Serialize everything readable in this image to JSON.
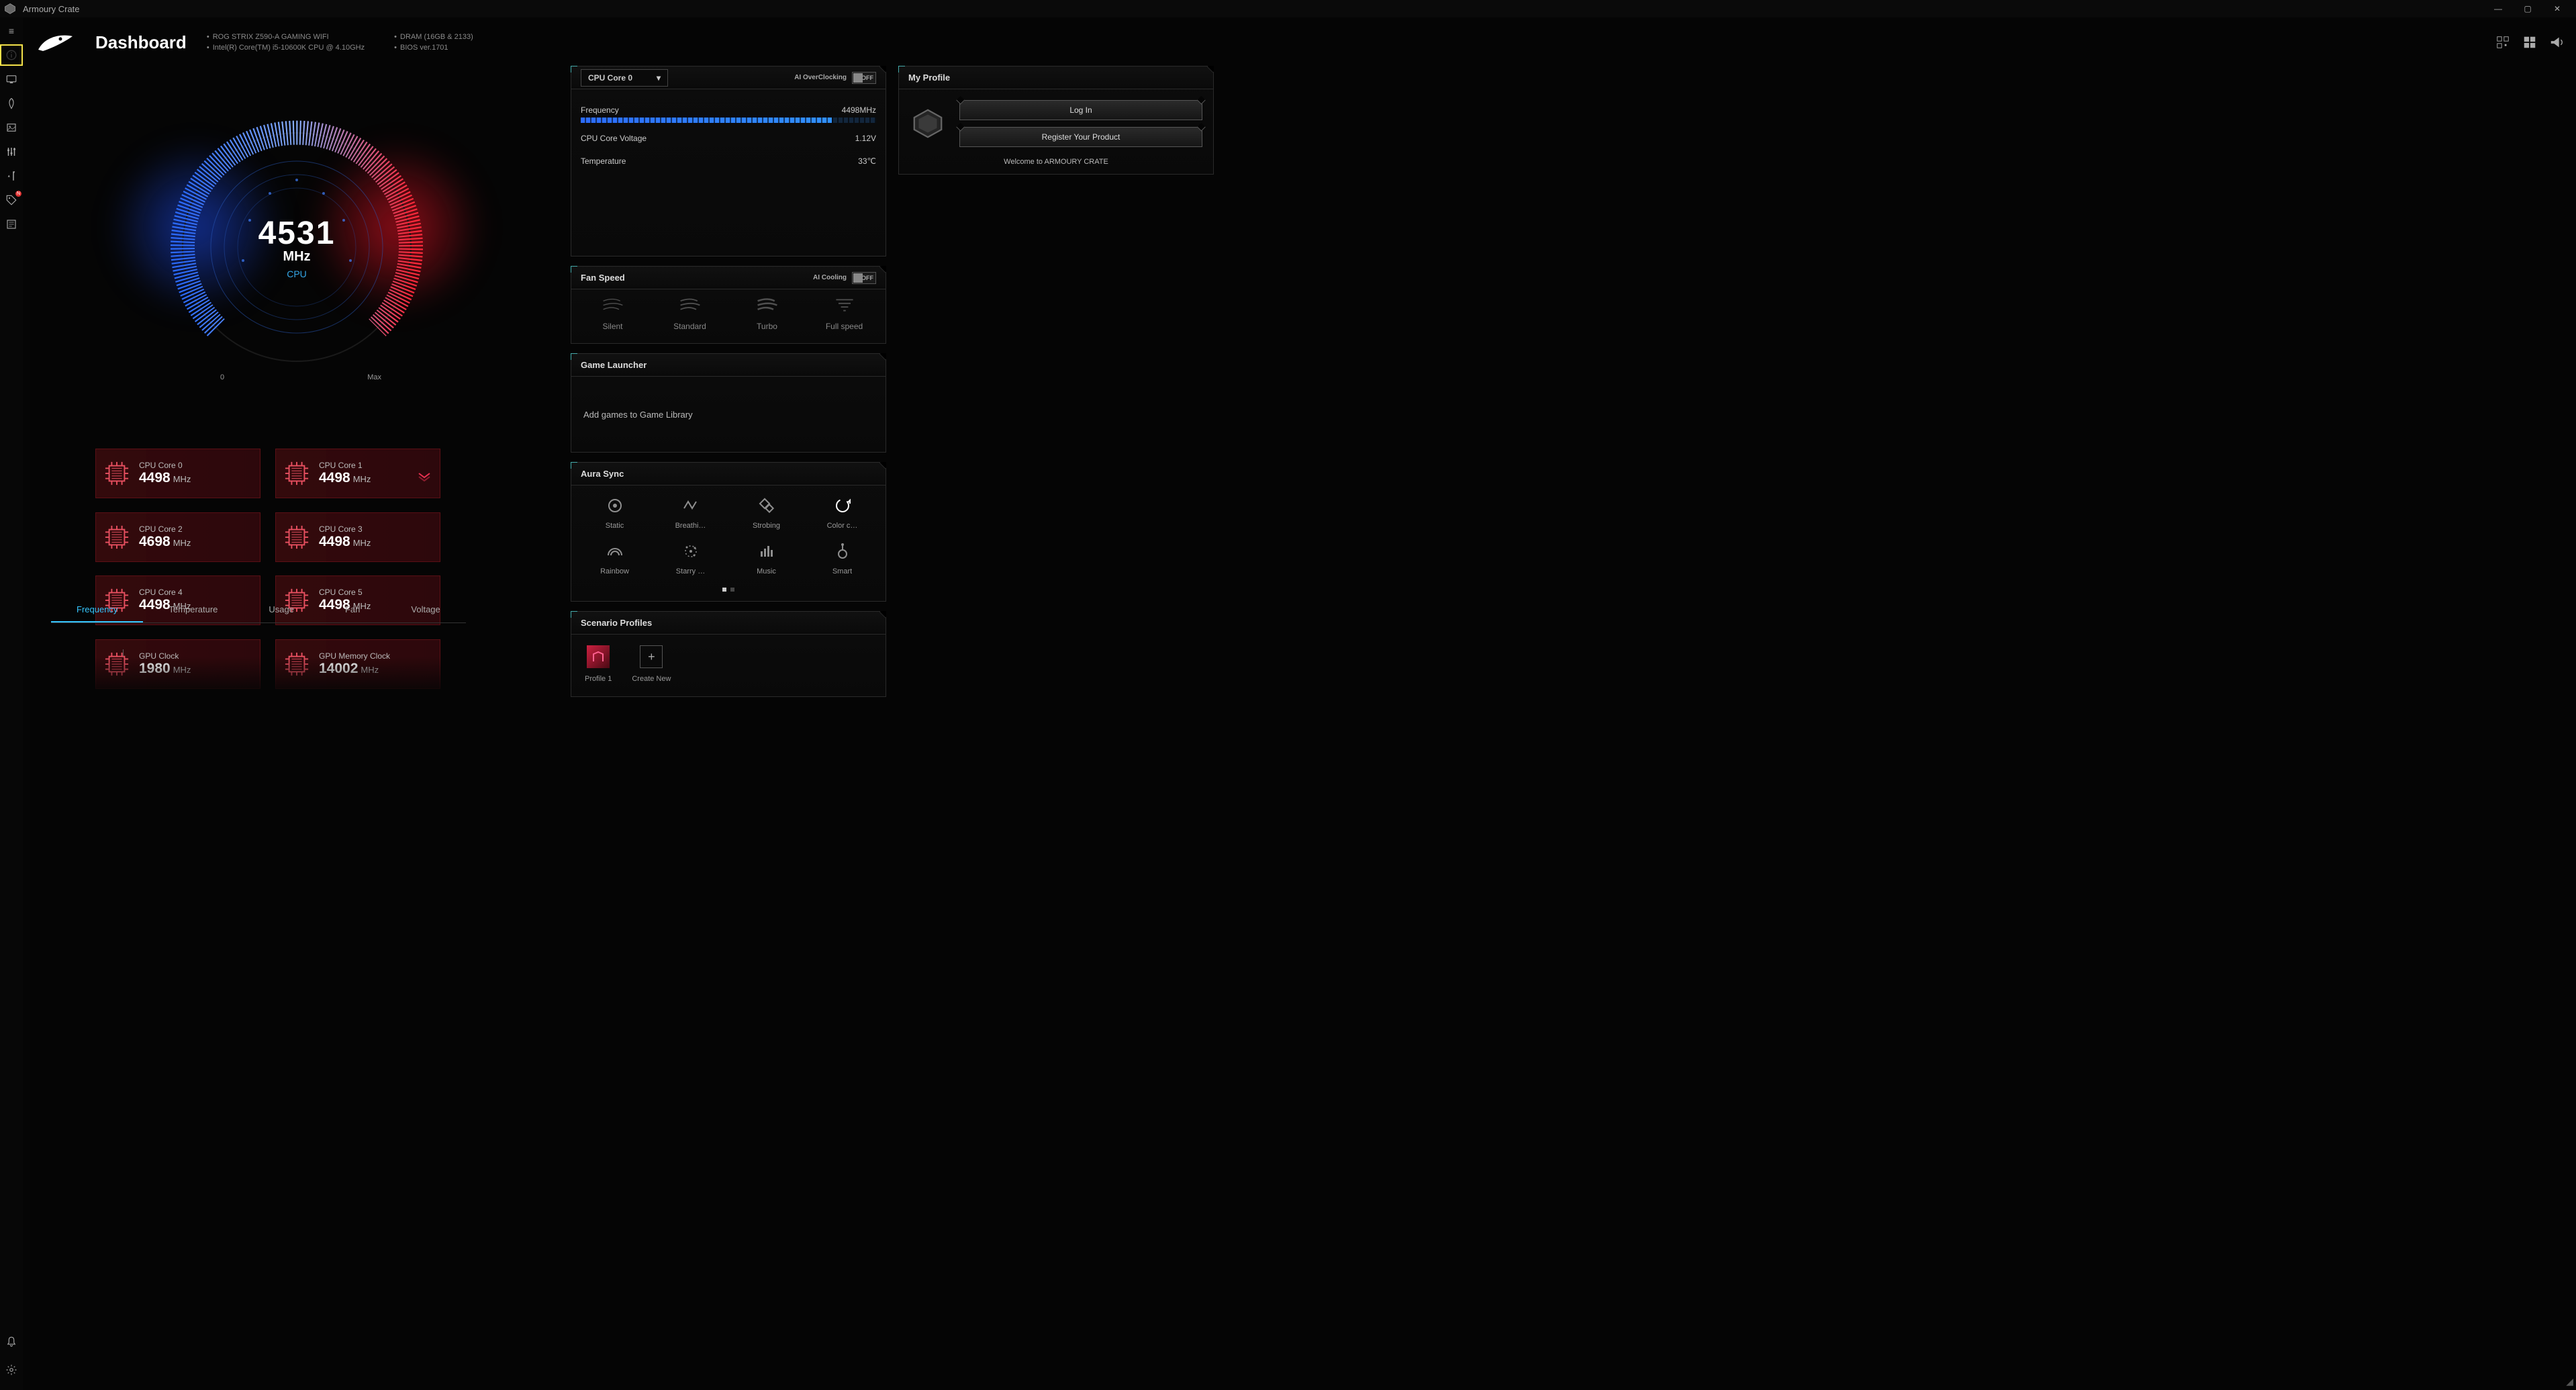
{
  "app": {
    "title": "Armoury Crate"
  },
  "window": {
    "minimize": "—",
    "maximize": "▢",
    "close": "✕"
  },
  "nav": {
    "menu": "≡"
  },
  "header": {
    "page_title": "Dashboard",
    "mobo": "ROG STRIX Z590-A GAMING WIFI",
    "cpu": "Intel(R) Core(TM) i5-10600K CPU @ 4.10GHz",
    "dram": "DRAM (16GB & 2133)",
    "bios": "BIOS ver.1701"
  },
  "gauge": {
    "value": "4531",
    "unit": "MHz",
    "source": "CPU",
    "min_label": "0",
    "max_label": "Max"
  },
  "cores": [
    {
      "name": "CPU Core 0",
      "value": "4498",
      "unit": "MHz"
    },
    {
      "name": "CPU Core 1",
      "value": "4498",
      "unit": "MHz"
    },
    {
      "name": "CPU Core 2",
      "value": "4698",
      "unit": "MHz"
    },
    {
      "name": "CPU Core 3",
      "value": "4498",
      "unit": "MHz"
    },
    {
      "name": "CPU Core 4",
      "value": "4498",
      "unit": "MHz"
    },
    {
      "name": "CPU Core 5",
      "value": "4498",
      "unit": "MHz"
    },
    {
      "name": "GPU Clock",
      "value": "1980",
      "unit": "MHz"
    },
    {
      "name": "GPU Memory Clock",
      "value": "14002",
      "unit": "MHz"
    }
  ],
  "tabs": {
    "items": [
      "Frequency",
      "Temperature",
      "Usage",
      "Fan",
      "Voltage"
    ],
    "active": 0
  },
  "cpu_card": {
    "selector": "CPU Core 0",
    "ai_label": "AI OverClocking",
    "ai_state": "OFF",
    "rows": {
      "freq_label": "Frequency",
      "freq_value": "4498MHz",
      "volt_label": "CPU Core Voltage",
      "volt_value": "1.12V",
      "temp_label": "Temperature",
      "temp_value": "33℃"
    }
  },
  "fan_card": {
    "title": "Fan Speed",
    "ai_label": "AI Cooling",
    "ai_state": "OFF",
    "modes": [
      "Silent",
      "Standard",
      "Turbo",
      "Full speed"
    ]
  },
  "game_launcher": {
    "title": "Game Launcher",
    "empty": "Add games to Game Library"
  },
  "aura": {
    "title": "Aura Sync",
    "items": [
      "Static",
      "Breathing",
      "Strobing",
      "Color cycle",
      "Rainbow",
      "Starry night",
      "Music",
      "Smart"
    ],
    "active": 3
  },
  "scenario": {
    "title": "Scenario Profiles",
    "profile1": "Profile 1",
    "create": "Create New"
  },
  "profile": {
    "title": "My Profile",
    "login": "Log In",
    "register": "Register Your Product",
    "welcome": "Welcome to ARMOURY CRATE"
  }
}
